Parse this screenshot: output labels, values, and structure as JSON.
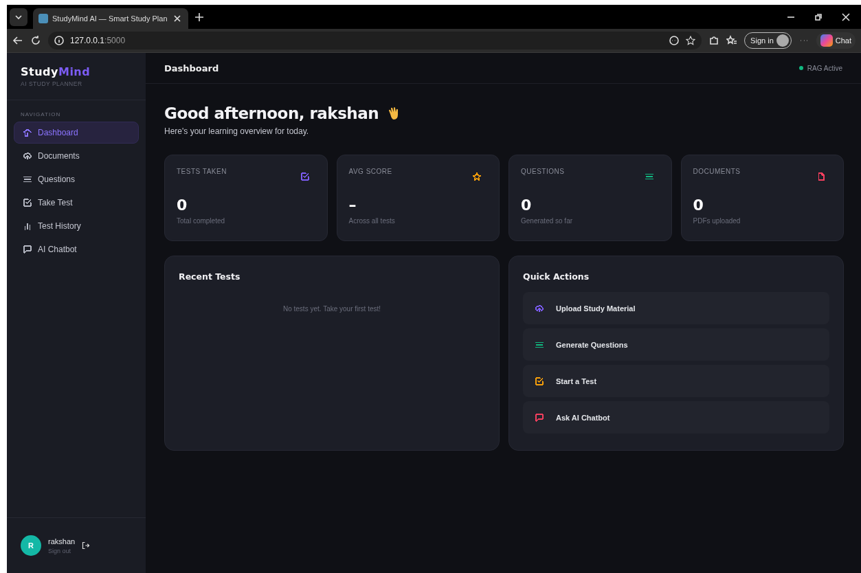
{
  "browser": {
    "tab_title": "StudyMind AI — Smart Study Plan",
    "url_host": "127.0.0.1",
    "url_port": ":5000",
    "sign_in": "Sign in",
    "chat": "Chat"
  },
  "sidebar": {
    "brand_main": "Study",
    "brand_accent": "Mind",
    "tagline": "AI STUDY PLANNER",
    "section": "NAVIGATION",
    "items": [
      {
        "label": "Dashboard",
        "kind": "home",
        "selected": true
      },
      {
        "label": "Documents",
        "kind": "upload",
        "selected": false
      },
      {
        "label": "Questions",
        "kind": "list",
        "selected": false
      },
      {
        "label": "Take Test",
        "kind": "check",
        "selected": false
      },
      {
        "label": "Test History",
        "kind": "bars",
        "selected": false
      },
      {
        "label": "AI Chatbot",
        "kind": "chat",
        "selected": false
      }
    ],
    "user": {
      "initial": "R",
      "name": "rakshan",
      "action": "Sign out"
    }
  },
  "header": {
    "title": "Dashboard",
    "status": {
      "text": "RAG Active",
      "color": "#10b981"
    }
  },
  "greeting": {
    "title": "Good afternoon, rakshan",
    "subtitle": "Here's your learning overview for today."
  },
  "stats": [
    {
      "label": "TESTS TAKEN",
      "value": "0",
      "note": "Total completed",
      "kind": "check",
      "color": "#7c5cf5"
    },
    {
      "label": "AVG SCORE",
      "value": "–",
      "note": "Across all tests",
      "kind": "star",
      "color": "#f59e0b"
    },
    {
      "label": "QUESTIONS",
      "value": "0",
      "note": "Generated so far",
      "kind": "list",
      "color": "#10b981"
    },
    {
      "label": "DOCUMENTS",
      "value": "0",
      "note": "PDFs uploaded",
      "kind": "file",
      "color": "#f43f5e"
    }
  ],
  "recent_tests": {
    "title": "Recent Tests",
    "empty": "No tests yet. Take your first test!"
  },
  "quick_actions": {
    "title": "Quick Actions",
    "items": [
      {
        "label": "Upload Study Material",
        "kind": "upload",
        "color": "#7c5cf5"
      },
      {
        "label": "Generate Questions",
        "kind": "list",
        "color": "#10b981"
      },
      {
        "label": "Start a Test",
        "kind": "check",
        "color": "#f59e0b"
      },
      {
        "label": "Ask AI Chatbot",
        "kind": "chat",
        "color": "#f43f5e"
      }
    ]
  }
}
